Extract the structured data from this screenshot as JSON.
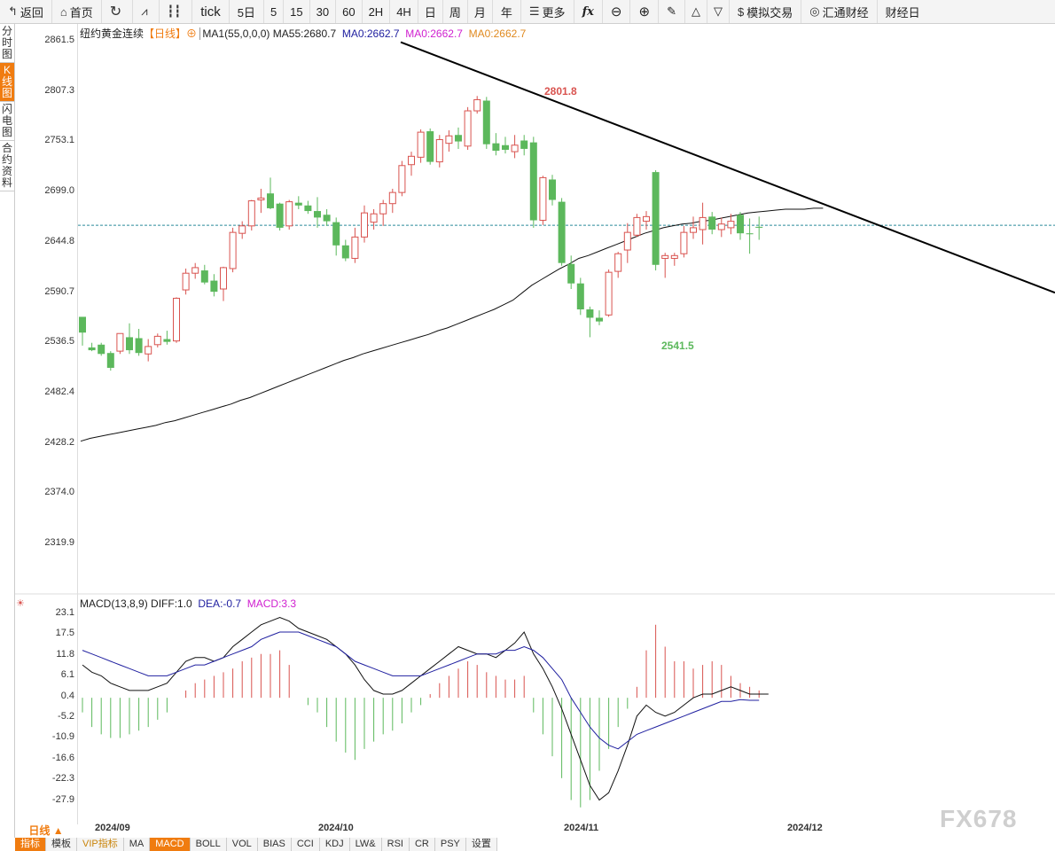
{
  "toolbar": {
    "back": "返回",
    "home": "首页",
    "tick": "tick",
    "periods": [
      "5日",
      "5",
      "15",
      "30",
      "60",
      "2H",
      "4H",
      "日",
      "周",
      "月",
      "年"
    ],
    "more": "更多",
    "fx_icon": "fx",
    "sim_trade": "模拟交易",
    "huitong": "汇通财经",
    "news": "财经日"
  },
  "side_tabs": [
    "分时图",
    "K线图",
    "闪电图",
    "合约资料"
  ],
  "main_legend": {
    "title": "纽约黄金连续",
    "period": "【日线】",
    "ma1": "MA1(55,0,0,0)",
    "ma55": "MA55:2680.7",
    "ma0a": "MA0:2662.7",
    "ma0b": "MA0:2662.7",
    "ma0c": "MA0:2662.7"
  },
  "macd_legend": {
    "name": "MACD(13,8,9)",
    "diff": "DIFF:1.0",
    "dea": "DEA:-0.7",
    "macd": "MACD:3.3"
  },
  "bottom": {
    "period_btn": "日线 ▲",
    "xlabels": [
      "2024/09",
      "2024/10",
      "2024/11",
      "2024/12"
    ],
    "tabs": [
      "指标",
      "模板",
      "VIP指标",
      "MA",
      "MACD",
      "BOLL",
      "VOL",
      "BIAS",
      "CCI",
      "KDJ",
      "LW&",
      "RSI",
      "CR",
      "PSY",
      "设置"
    ]
  },
  "watermark": "FX678",
  "colors": {
    "up": "#d9534f",
    "down": "#5cb85c",
    "accent": "#f07c10",
    "dea": "#2020a0",
    "macd_label": "#d020d0"
  },
  "chart_data": {
    "type": "candlestick",
    "title": "纽约黄金连续",
    "ylim": [
      2300,
      2875
    ],
    "yticks": [
      "2861.5",
      "2807.3",
      "2753.1",
      "2699.0",
      "2644.8",
      "2590.7",
      "2536.5",
      "2482.4",
      "2428.2",
      "2374.0",
      "2319.9"
    ],
    "current_price": 2662.7,
    "annotations": {
      "high": "2801.8",
      "low": "2541.5"
    },
    "candles": [
      {
        "o": 2547,
        "h": 2562,
        "l": 2533,
        "c": 2564,
        "color": "down"
      },
      {
        "o": 2531,
        "h": 2536,
        "l": 2527,
        "c": 2528,
        "color": "down"
      },
      {
        "o": 2534,
        "h": 2536,
        "l": 2522,
        "c": 2524,
        "color": "down"
      },
      {
        "o": 2525,
        "h": 2527,
        "l": 2506,
        "c": 2509,
        "color": "down"
      },
      {
        "o": 2527,
        "h": 2546,
        "l": 2524,
        "c": 2546,
        "color": "up"
      },
      {
        "o": 2542,
        "h": 2557,
        "l": 2524,
        "c": 2528,
        "color": "down"
      },
      {
        "o": 2541,
        "h": 2551,
        "l": 2522,
        "c": 2525,
        "color": "down"
      },
      {
        "o": 2524,
        "h": 2540,
        "l": 2516,
        "c": 2532,
        "color": "up"
      },
      {
        "o": 2534,
        "h": 2546,
        "l": 2531,
        "c": 2543,
        "color": "up"
      },
      {
        "o": 2540,
        "h": 2549,
        "l": 2534,
        "c": 2537,
        "color": "down"
      },
      {
        "o": 2538,
        "h": 2585,
        "l": 2536,
        "c": 2584,
        "color": "up"
      },
      {
        "o": 2593,
        "h": 2616,
        "l": 2588,
        "c": 2611,
        "color": "up"
      },
      {
        "o": 2611,
        "h": 2622,
        "l": 2605,
        "c": 2617,
        "color": "up"
      },
      {
        "o": 2614,
        "h": 2620,
        "l": 2599,
        "c": 2601,
        "color": "down"
      },
      {
        "o": 2603,
        "h": 2610,
        "l": 2586,
        "c": 2591,
        "color": "down"
      },
      {
        "o": 2594,
        "h": 2618,
        "l": 2581,
        "c": 2617,
        "color": "up"
      },
      {
        "o": 2616,
        "h": 2660,
        "l": 2612,
        "c": 2655,
        "color": "up"
      },
      {
        "o": 2654,
        "h": 2667,
        "l": 2648,
        "c": 2662,
        "color": "up"
      },
      {
        "o": 2662,
        "h": 2690,
        "l": 2657,
        "c": 2689,
        "color": "up"
      },
      {
        "o": 2690,
        "h": 2702,
        "l": 2676,
        "c": 2692,
        "color": "up"
      },
      {
        "o": 2697,
        "h": 2714,
        "l": 2680,
        "c": 2681,
        "color": "down"
      },
      {
        "o": 2686,
        "h": 2687,
        "l": 2657,
        "c": 2660,
        "color": "down"
      },
      {
        "o": 2662,
        "h": 2690,
        "l": 2658,
        "c": 2688,
        "color": "up"
      },
      {
        "o": 2687,
        "h": 2694,
        "l": 2680,
        "c": 2684,
        "color": "down"
      },
      {
        "o": 2684,
        "h": 2689,
        "l": 2675,
        "c": 2678,
        "color": "down"
      },
      {
        "o": 2678,
        "h": 2693,
        "l": 2660,
        "c": 2671,
        "color": "down"
      },
      {
        "o": 2674,
        "h": 2680,
        "l": 2662,
        "c": 2667,
        "color": "down"
      },
      {
        "o": 2666,
        "h": 2671,
        "l": 2630,
        "c": 2641,
        "color": "down"
      },
      {
        "o": 2641,
        "h": 2647,
        "l": 2624,
        "c": 2627,
        "color": "down"
      },
      {
        "o": 2627,
        "h": 2660,
        "l": 2622,
        "c": 2650,
        "color": "up"
      },
      {
        "o": 2650,
        "h": 2684,
        "l": 2644,
        "c": 2676,
        "color": "up"
      },
      {
        "o": 2666,
        "h": 2680,
        "l": 2658,
        "c": 2675,
        "color": "up"
      },
      {
        "o": 2675,
        "h": 2690,
        "l": 2662,
        "c": 2686,
        "color": "up"
      },
      {
        "o": 2686,
        "h": 2702,
        "l": 2676,
        "c": 2698,
        "color": "up"
      },
      {
        "o": 2698,
        "h": 2732,
        "l": 2694,
        "c": 2727,
        "color": "up"
      },
      {
        "o": 2728,
        "h": 2742,
        "l": 2716,
        "c": 2737,
        "color": "up"
      },
      {
        "o": 2736,
        "h": 2766,
        "l": 2730,
        "c": 2763,
        "color": "up"
      },
      {
        "o": 2764,
        "h": 2767,
        "l": 2728,
        "c": 2731,
        "color": "down"
      },
      {
        "o": 2731,
        "h": 2760,
        "l": 2725,
        "c": 2755,
        "color": "up"
      },
      {
        "o": 2751,
        "h": 2765,
        "l": 2742,
        "c": 2759,
        "color": "up"
      },
      {
        "o": 2760,
        "h": 2768,
        "l": 2745,
        "c": 2753,
        "color": "down"
      },
      {
        "o": 2748,
        "h": 2790,
        "l": 2744,
        "c": 2786,
        "color": "up"
      },
      {
        "o": 2786,
        "h": 2802,
        "l": 2783,
        "c": 2798,
        "color": "up"
      },
      {
        "o": 2797,
        "h": 2801,
        "l": 2745,
        "c": 2750,
        "color": "down"
      },
      {
        "o": 2751,
        "h": 2762,
        "l": 2738,
        "c": 2743,
        "color": "down"
      },
      {
        "o": 2744,
        "h": 2758,
        "l": 2740,
        "c": 2749,
        "color": "down"
      },
      {
        "o": 2742,
        "h": 2760,
        "l": 2735,
        "c": 2749,
        "color": "up"
      },
      {
        "o": 2754,
        "h": 2760,
        "l": 2738,
        "c": 2745,
        "color": "down"
      },
      {
        "o": 2752,
        "h": 2758,
        "l": 2660,
        "c": 2668,
        "color": "down"
      },
      {
        "o": 2668,
        "h": 2716,
        "l": 2663,
        "c": 2714,
        "color": "up"
      },
      {
        "o": 2712,
        "h": 2717,
        "l": 2684,
        "c": 2690,
        "color": "down"
      },
      {
        "o": 2688,
        "h": 2692,
        "l": 2619,
        "c": 2622,
        "color": "down"
      },
      {
        "o": 2621,
        "h": 2630,
        "l": 2594,
        "c": 2600,
        "color": "down"
      },
      {
        "o": 2600,
        "h": 2606,
        "l": 2566,
        "c": 2572,
        "color": "down"
      },
      {
        "o": 2572,
        "h": 2575,
        "l": 2542,
        "c": 2563,
        "color": "down"
      },
      {
        "o": 2563,
        "h": 2571,
        "l": 2555,
        "c": 2559,
        "color": "down"
      },
      {
        "o": 2566,
        "h": 2615,
        "l": 2564,
        "c": 2612,
        "color": "up"
      },
      {
        "o": 2613,
        "h": 2634,
        "l": 2606,
        "c": 2632,
        "color": "up"
      },
      {
        "o": 2636,
        "h": 2665,
        "l": 2622,
        "c": 2655,
        "color": "up"
      },
      {
        "o": 2652,
        "h": 2675,
        "l": 2650,
        "c": 2671,
        "color": "up"
      },
      {
        "o": 2667,
        "h": 2678,
        "l": 2658,
        "c": 2672,
        "color": "up"
      },
      {
        "o": 2720,
        "h": 2722,
        "l": 2614,
        "c": 2620,
        "color": "down"
      },
      {
        "o": 2630,
        "h": 2633,
        "l": 2606,
        "c": 2627,
        "color": "up"
      },
      {
        "o": 2627,
        "h": 2633,
        "l": 2619,
        "c": 2630,
        "color": "up"
      },
      {
        "o": 2632,
        "h": 2662,
        "l": 2628,
        "c": 2655,
        "color": "up"
      },
      {
        "o": 2655,
        "h": 2672,
        "l": 2648,
        "c": 2660,
        "color": "up"
      },
      {
        "o": 2658,
        "h": 2687,
        "l": 2642,
        "c": 2671,
        "color": "up"
      },
      {
        "o": 2672,
        "h": 2677,
        "l": 2653,
        "c": 2658,
        "color": "down"
      },
      {
        "o": 2658,
        "h": 2671,
        "l": 2650,
        "c": 2664,
        "color": "up"
      },
      {
        "o": 2667,
        "h": 2675,
        "l": 2653,
        "c": 2660,
        "color": "up"
      },
      {
        "o": 2674,
        "h": 2677,
        "l": 2647,
        "c": 2654,
        "color": "down"
      },
      {
        "o": 2654,
        "h": 2670,
        "l": 2632,
        "c": 2653,
        "color": "down"
      },
      {
        "o": 2660,
        "h": 2672,
        "l": 2647,
        "c": 2661,
        "color": "down"
      }
    ],
    "ma55": [
      2430,
      2433,
      2435,
      2437,
      2439,
      2441,
      2443,
      2445,
      2447,
      2450,
      2452,
      2455,
      2458,
      2461,
      2464,
      2467,
      2470,
      2474,
      2477,
      2481,
      2485,
      2489,
      2493,
      2497,
      2501,
      2505,
      2509,
      2513,
      2517,
      2520,
      2524,
      2527,
      2530,
      2533,
      2536,
      2539,
      2542,
      2545,
      2549,
      2552,
      2556,
      2560,
      2564,
      2568,
      2572,
      2577,
      2582,
      2590,
      2598,
      2604,
      2610,
      2616,
      2621,
      2627,
      2630,
      2634,
      2638,
      2642,
      2646,
      2650,
      2654,
      2657,
      2660,
      2662,
      2664,
      2665,
      2667,
      2668,
      2670,
      2672,
      2674,
      2676,
      2677,
      2678,
      2679,
      2680,
      2680,
      2680,
      2681,
      2681
    ],
    "trendline": {
      "from": {
        "x": "2024/09/25",
        "y": 2860
      },
      "to": {
        "x": "2024/12/31",
        "y": 2590
      }
    },
    "macd": {
      "ylim": [
        -31,
        25
      ],
      "yticks": [
        "23.1",
        "17.5",
        "11.8",
        "6.1",
        "0.4",
        "-5.2",
        "-10.9",
        "-16.6",
        "-22.3",
        "-27.9"
      ],
      "diff": [
        9,
        7,
        6,
        4,
        3,
        2,
        2,
        2,
        3,
        4,
        7,
        10,
        11,
        11,
        10,
        11,
        14,
        16,
        18,
        20,
        21,
        22,
        21,
        19,
        18,
        17,
        16,
        14,
        12,
        9,
        5,
        2,
        1,
        1,
        2,
        4,
        6,
        8,
        10,
        12,
        14,
        13,
        12,
        12,
        11,
        13,
        15,
        18,
        12,
        8,
        3,
        -3,
        -10,
        -17,
        -24,
        -28,
        -26,
        -20,
        -13,
        -5,
        -2,
        -4,
        -5,
        -4,
        -2,
        0,
        1,
        1,
        2,
        3,
        2,
        1,
        1,
        1
      ],
      "dea": [
        13,
        12,
        11,
        10,
        9,
        8,
        7,
        6,
        6,
        6,
        7,
        8,
        9,
        9,
        10,
        11,
        12,
        13,
        14,
        16,
        17,
        18,
        18,
        18,
        17,
        16,
        15,
        14,
        12,
        10,
        9,
        8,
        7,
        6,
        6,
        6,
        6,
        7,
        8,
        9,
        10,
        11,
        12,
        12,
        12,
        13,
        13,
        14,
        13,
        11,
        8,
        5,
        0,
        -4,
        -8,
        -11,
        -13,
        -14,
        -12,
        -10,
        -9,
        -8,
        -7,
        -6,
        -5,
        -4,
        -3,
        -2,
        -1,
        -1,
        -0.5,
        -0.7,
        -0.7
      ],
      "histogram": [
        -4,
        -8,
        -10,
        -11,
        -11,
        -10,
        -9,
        -8,
        -6,
        -4,
        0,
        2,
        4,
        5,
        6,
        7,
        8,
        10,
        11,
        12,
        12,
        13,
        9,
        0,
        -2,
        -4,
        -8,
        -12,
        -15,
        -17,
        -14,
        -12,
        -10,
        -9,
        -7,
        -4,
        -2,
        1,
        4,
        6,
        8,
        10,
        9,
        7,
        6,
        5,
        5,
        6,
        -4,
        -10,
        -16,
        -22,
        -28,
        -30,
        -28,
        -20,
        -14,
        -8,
        -3,
        3,
        13,
        20,
        14,
        10,
        10,
        8,
        9,
        10,
        9,
        6,
        4,
        3,
        2
      ]
    }
  }
}
